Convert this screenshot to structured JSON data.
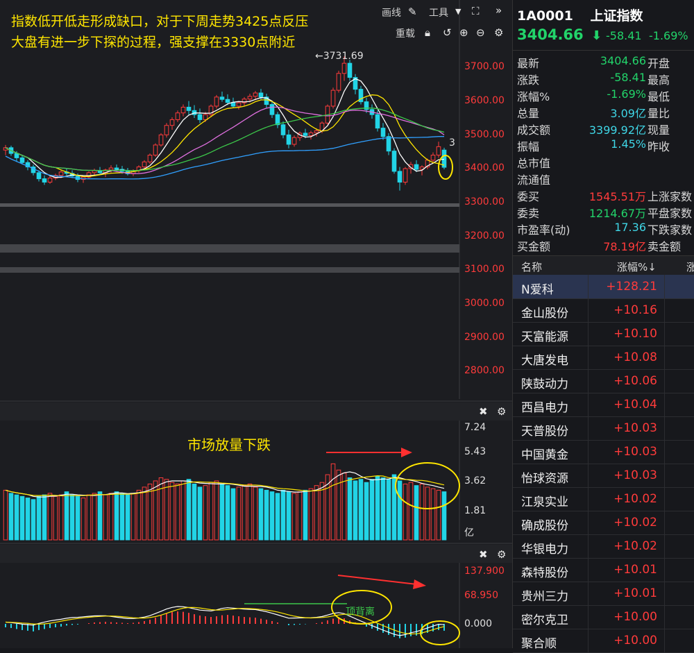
{
  "toolbar": {
    "draw_label": "画线",
    "tools_label": "工具",
    "reload_label": "重载"
  },
  "annotations": {
    "line1": "指数低开低走形成缺口，对于下周走势3425点反压",
    "line2": "大盘有进一步下探的过程，强支撑在3330点附近",
    "volume_note": "市场放量下跌",
    "macd_note": "顶背离",
    "high_marker": "←3731.69",
    "gap_marker": "3"
  },
  "price_axis": [
    "3700.00",
    "3600.00",
    "3500.00",
    "3400.00",
    "3300.00",
    "3200.00",
    "3100.00",
    "3000.00",
    "2900.00",
    "2800.00"
  ],
  "volume_axis": [
    "7.24",
    "5.43",
    "3.62",
    "1.81",
    "亿"
  ],
  "macd_axis": [
    "137.900",
    "68.950",
    "0.000"
  ],
  "colors": {
    "up": "#ff3b3b",
    "down": "#22d4e6",
    "ma5": "#ffffff",
    "ma10": "#ffe600",
    "ma20": "#e070e0",
    "ma30": "#3cc84a",
    "ma60": "#30a0ff",
    "accent": "#ffe600"
  },
  "icons": [
    "pencil-icon",
    "caret-down-icon",
    "fullscreen-icon",
    "double-chevron-icon",
    "lock-icon",
    "undo-icon",
    "zoom-in-icon",
    "zoom-out-icon",
    "gear-icon",
    "close-icon"
  ],
  "chart_data": {
    "type": "candlestick",
    "ylim": [
      2750,
      3780
    ],
    "candles": [
      [
        3455,
        3470,
        3440,
        3462
      ],
      [
        3462,
        3468,
        3438,
        3445
      ],
      [
        3445,
        3452,
        3420,
        3432
      ],
      [
        3432,
        3440,
        3412,
        3418
      ],
      [
        3418,
        3425,
        3395,
        3405
      ],
      [
        3405,
        3412,
        3380,
        3388
      ],
      [
        3388,
        3395,
        3362,
        3370
      ],
      [
        3370,
        3380,
        3352,
        3360
      ],
      [
        3360,
        3378,
        3355,
        3372
      ],
      [
        3372,
        3385,
        3366,
        3380
      ],
      [
        3380,
        3395,
        3372,
        3390
      ],
      [
        3390,
        3402,
        3380,
        3386
      ],
      [
        3386,
        3395,
        3372,
        3378
      ],
      [
        3378,
        3386,
        3360,
        3368
      ],
      [
        3368,
        3380,
        3358,
        3375
      ],
      [
        3375,
        3392,
        3370,
        3388
      ],
      [
        3388,
        3400,
        3378,
        3394
      ],
      [
        3394,
        3405,
        3382,
        3388
      ],
      [
        3388,
        3400,
        3375,
        3396
      ],
      [
        3396,
        3410,
        3388,
        3402
      ],
      [
        3402,
        3412,
        3392,
        3398
      ],
      [
        3398,
        3408,
        3385,
        3392
      ],
      [
        3392,
        3402,
        3380,
        3385
      ],
      [
        3385,
        3398,
        3378,
        3394
      ],
      [
        3394,
        3410,
        3388,
        3405
      ],
      [
        3405,
        3425,
        3400,
        3420
      ],
      [
        3420,
        3445,
        3414,
        3440
      ],
      [
        3440,
        3475,
        3435,
        3470
      ],
      [
        3470,
        3505,
        3465,
        3500
      ],
      [
        3500,
        3535,
        3492,
        3528
      ],
      [
        3528,
        3552,
        3515,
        3545
      ],
      [
        3545,
        3572,
        3538,
        3565
      ],
      [
        3565,
        3590,
        3555,
        3582
      ],
      [
        3582,
        3600,
        3560,
        3572
      ],
      [
        3572,
        3588,
        3550,
        3560
      ],
      [
        3560,
        3578,
        3535,
        3545
      ],
      [
        3545,
        3568,
        3538,
        3560
      ],
      [
        3560,
        3590,
        3552,
        3585
      ],
      [
        3585,
        3618,
        3578,
        3612
      ],
      [
        3612,
        3628,
        3598,
        3605
      ],
      [
        3605,
        3620,
        3588,
        3596
      ],
      [
        3596,
        3610,
        3580,
        3585
      ],
      [
        3585,
        3600,
        3575,
        3595
      ],
      [
        3595,
        3612,
        3586,
        3606
      ],
      [
        3606,
        3622,
        3596,
        3614
      ],
      [
        3614,
        3630,
        3603,
        3624
      ],
      [
        3624,
        3636,
        3605,
        3612
      ],
      [
        3612,
        3622,
        3580,
        3590
      ],
      [
        3590,
        3598,
        3550,
        3560
      ],
      [
        3560,
        3568,
        3520,
        3530
      ],
      [
        3530,
        3540,
        3490,
        3500
      ],
      [
        3500,
        3515,
        3460,
        3472
      ],
      [
        3472,
        3498,
        3465,
        3492
      ],
      [
        3492,
        3510,
        3482,
        3505
      ],
      [
        3505,
        3518,
        3490,
        3498
      ],
      [
        3498,
        3512,
        3486,
        3506
      ],
      [
        3506,
        3520,
        3495,
        3512
      ],
      [
        3512,
        3540,
        3505,
        3535
      ],
      [
        3535,
        3590,
        3530,
        3585
      ],
      [
        3585,
        3640,
        3578,
        3632
      ],
      [
        3632,
        3690,
        3625,
        3682
      ],
      [
        3682,
        3732,
        3660,
        3712
      ],
      [
        3712,
        3722,
        3660,
        3670
      ],
      [
        3670,
        3680,
        3620,
        3635
      ],
      [
        3635,
        3645,
        3590,
        3598
      ],
      [
        3598,
        3610,
        3565,
        3575
      ],
      [
        3575,
        3590,
        3548,
        3560
      ],
      [
        3560,
        3572,
        3510,
        3520
      ],
      [
        3520,
        3535,
        3485,
        3495
      ],
      [
        3495,
        3505,
        3440,
        3452
      ],
      [
        3452,
        3460,
        3385,
        3392
      ],
      [
        3392,
        3405,
        3335,
        3360
      ],
      [
        3360,
        3405,
        3352,
        3400
      ],
      [
        3400,
        3420,
        3385,
        3412
      ],
      [
        3412,
        3425,
        3390,
        3398
      ],
      [
        3398,
        3410,
        3380,
        3405
      ],
      [
        3405,
        3430,
        3398,
        3425
      ],
      [
        3425,
        3448,
        3418,
        3440
      ],
      [
        3440,
        3480,
        3432,
        3465
      ],
      [
        3455,
        3462,
        3398,
        3404
      ]
    ],
    "volume": [
      3.2,
      3.0,
      2.9,
      2.8,
      2.7,
      2.6,
      2.8,
      2.9,
      3.0,
      2.8,
      2.9,
      3.1,
      2.9,
      2.8,
      2.7,
      2.9,
      3.0,
      3.1,
      2.9,
      3.0,
      3.1,
      3.0,
      2.9,
      3.0,
      3.2,
      3.4,
      3.6,
      3.8,
      4.0,
      3.9,
      3.7,
      3.6,
      3.8,
      3.9,
      3.6,
      3.4,
      3.5,
      3.7,
      3.8,
      3.6,
      3.5,
      3.3,
      3.4,
      3.5,
      3.6,
      3.4,
      3.3,
      3.2,
      3.1,
      3.0,
      3.2,
      3.1,
      3.0,
      3.1,
      3.2,
      3.3,
      3.5,
      3.7,
      4.2,
      4.9,
      4.5,
      4.3,
      4.0,
      3.8,
      3.9,
      3.7,
      3.9,
      4.1,
      4.0,
      3.9,
      4.2,
      3.8,
      3.6,
      3.7,
      3.5,
      3.6,
      3.4,
      3.3,
      3.2,
      3.1
    ],
    "macd_hist": [
      -10,
      -12,
      -15,
      -18,
      -20,
      -22,
      -18,
      -15,
      -12,
      -10,
      -8,
      -5,
      -3,
      -2,
      0,
      2,
      4,
      5,
      6,
      5,
      4,
      3,
      2,
      3,
      5,
      8,
      12,
      18,
      24,
      30,
      34,
      36,
      35,
      32,
      28,
      24,
      22,
      20,
      22,
      25,
      26,
      24,
      22,
      20,
      19,
      18,
      15,
      12,
      8,
      4,
      0,
      -4,
      -3,
      -2,
      -1,
      0,
      2,
      5,
      10,
      15,
      18,
      16,
      10,
      4,
      -2,
      -8,
      -14,
      -20,
      -26,
      -32,
      -38,
      -42,
      -40,
      -36,
      -34,
      -30,
      -26,
      -22,
      -18,
      -20
    ]
  },
  "quote": {
    "code": "1A0001",
    "name": "上证指数",
    "price": "3404.66",
    "arrow": "⬇",
    "change": "-58.41",
    "change_pct": "-1.69%",
    "rows": [
      {
        "label": "最新",
        "value": "3404.66",
        "color": "green",
        "label2": "开盘"
      },
      {
        "label": "涨跌",
        "value": "-58.41",
        "color": "green",
        "label2": "最高"
      },
      {
        "label": "涨幅%",
        "value": "-1.69%",
        "color": "green",
        "label2": "最低"
      },
      {
        "label": "总量",
        "value": "3.09亿",
        "color": "cyan",
        "label2": "量比"
      },
      {
        "label": "成交额",
        "value": "3399.92亿",
        "color": "cyan",
        "label2": "现量"
      },
      {
        "label": "振幅",
        "value": "1.45%",
        "color": "cyan",
        "label2": "昨收"
      },
      {
        "label": "总市值",
        "value": "",
        "color": "cyan",
        "label2": ""
      },
      {
        "label": "流通值",
        "value": "",
        "color": "cyan",
        "label2": ""
      },
      {
        "label": "委买",
        "value": "1545.51万",
        "color": "red",
        "label2": "上涨家数"
      },
      {
        "label": "委卖",
        "value": "1214.67万",
        "color": "green",
        "label2": "平盘家数"
      },
      {
        "label": "市盈率(动)",
        "value": "17.36",
        "color": "cyan",
        "label2": "下跌家数"
      },
      {
        "label": "买金额",
        "value": "78.19亿",
        "color": "red",
        "label2": "卖金额"
      }
    ]
  },
  "stock_list": {
    "header": {
      "name": "名称",
      "pct": "涨幅%↓",
      "extra": "涨"
    },
    "rows": [
      {
        "name": "N爱科",
        "pct": "+128.21"
      },
      {
        "name": "金山股份",
        "pct": "+10.16"
      },
      {
        "name": "天富能源",
        "pct": "+10.10"
      },
      {
        "name": "大唐发电",
        "pct": "+10.08"
      },
      {
        "name": "陕鼓动力",
        "pct": "+10.06"
      },
      {
        "name": "西昌电力",
        "pct": "+10.04"
      },
      {
        "name": "天普股份",
        "pct": "+10.03"
      },
      {
        "name": "中国黄金",
        "pct": "+10.03"
      },
      {
        "name": "怡球资源",
        "pct": "+10.03"
      },
      {
        "name": "江泉实业",
        "pct": "+10.02"
      },
      {
        "name": "确成股份",
        "pct": "+10.02"
      },
      {
        "name": "华银电力",
        "pct": "+10.02"
      },
      {
        "name": "森特股份",
        "pct": "+10.01"
      },
      {
        "name": "贵州三力",
        "pct": "+10.01"
      },
      {
        "name": "密尔克卫",
        "pct": "+10.00"
      },
      {
        "name": "聚合顺",
        "pct": "+10.00"
      }
    ]
  }
}
